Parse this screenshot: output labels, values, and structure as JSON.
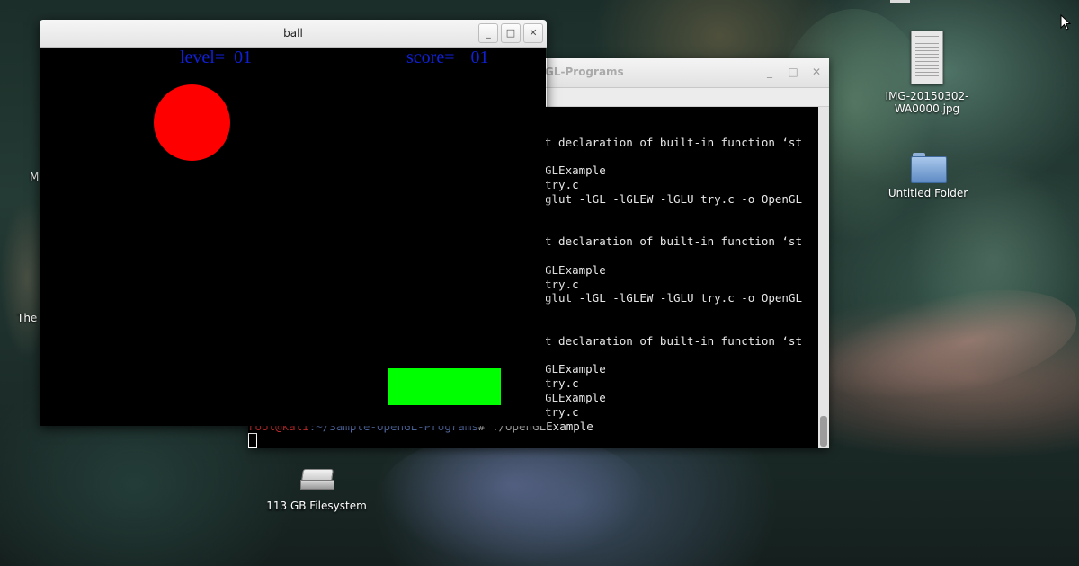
{
  "ball_window": {
    "title": "ball",
    "hud": {
      "level_label": "level=",
      "level_value": "01",
      "score_label": "score=",
      "score_value": "01"
    },
    "colors": {
      "background": "#000000",
      "ball": "#ff0000",
      "paddle": "#00ff00",
      "hud_text": "#1020d8"
    },
    "buttons": {
      "minimize_icon": "minimize-icon",
      "maximize_icon": "maximize-icon",
      "close_icon": "close-icon"
    }
  },
  "terminal": {
    "title_fragment": "GL-Programs",
    "lines": [
      "",
      "",
      "t declaration of built-in function ‘st",
      "",
      "GLExample",
      "try.c",
      "glut -lGL -lGLEW -lGLU try.c -o OpenGL",
      "",
      "",
      "t declaration of built-in function ‘st",
      "",
      "GLExample",
      "try.c",
      "glut -lGL -lGLEW -lGLU try.c -o OpenGL",
      "",
      "",
      "t declaration of built-in function ‘st",
      "",
      "GLExample",
      "try.c",
      "GLExample",
      "try.c"
    ],
    "prompt": {
      "user": "root@kali",
      "path": ":~/Sample-OpenGL-Programs",
      "command": "# ./OpenGLExample"
    }
  },
  "desktop": {
    "icons": [
      {
        "label_line1": "IMG-20150302-",
        "label_line2": "WA0000.jpg"
      },
      {
        "label": "Untitled Folder"
      },
      {
        "label": "113 GB Filesystem"
      }
    ],
    "partial_labels": [
      "M",
      "The"
    ]
  }
}
